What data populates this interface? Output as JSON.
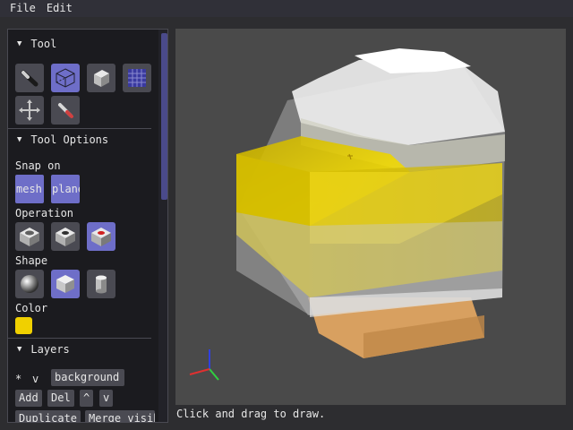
{
  "menu": {
    "file": "File",
    "edit": "Edit"
  },
  "tool_section": {
    "title": "Tool",
    "tools": [
      "brush-icon",
      "select-box-icon",
      "cube-icon",
      "grid-icon",
      "move-icon",
      "eyedropper-icon"
    ],
    "active_tool": "select-box-icon"
  },
  "tool_options": {
    "title": "Tool Options",
    "snap_label": "Snap on",
    "snap_mesh": "mesh",
    "snap_plane": "plane",
    "operation_label": "Operation",
    "shape_label": "Shape",
    "color_label": "Color",
    "color_value": "#f0d000"
  },
  "layers": {
    "title": "Layers",
    "row_active_marker": "*",
    "row_visible_marker": "v",
    "row_name": "background",
    "add": "Add",
    "del": "Del",
    "up": "^",
    "down": "v",
    "duplicate": "Duplicate",
    "merge": "Merge visible"
  },
  "status": "Click and drag to draw.",
  "colors": {
    "accent": "#6e6ec8",
    "voxel_yellow": "#f0d000",
    "voxel_orange": "#e0a850"
  }
}
